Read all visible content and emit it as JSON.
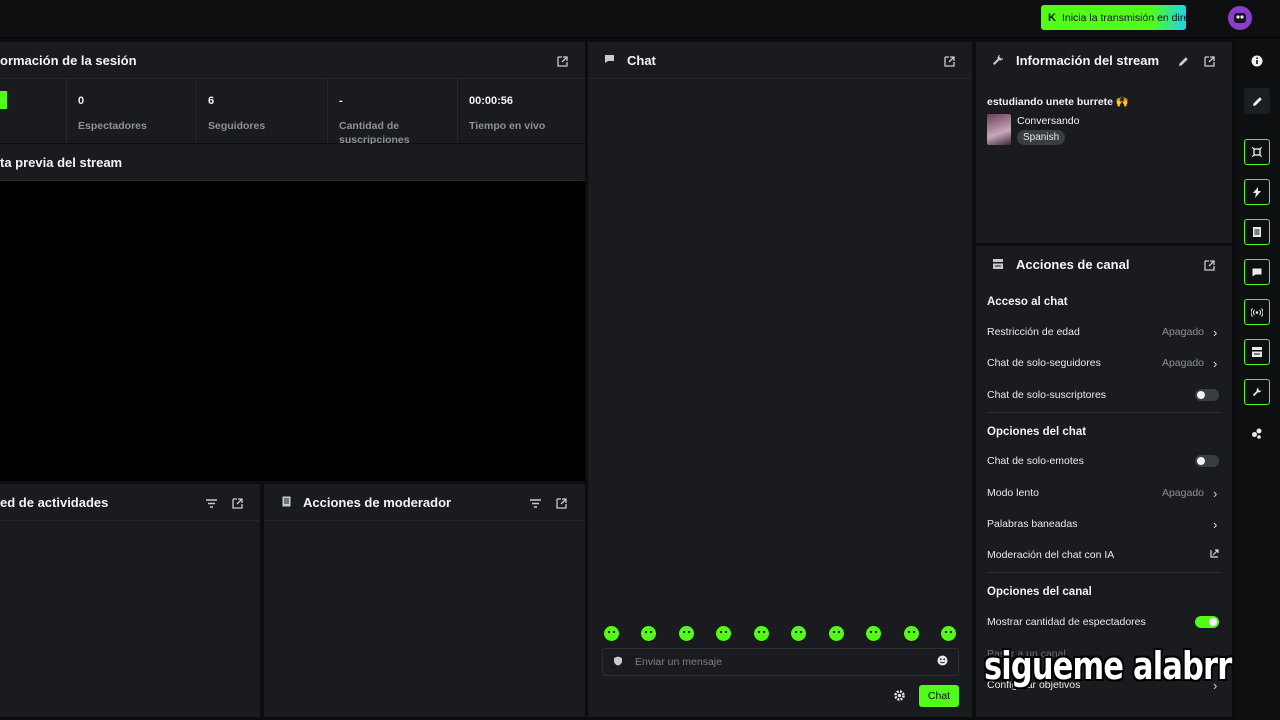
{
  "topbar": {
    "go_live_label": "Inicia la transmisión en directo",
    "accent": "#53fc18"
  },
  "session": {
    "title": "ormación de la sesión",
    "stats": [
      {
        "value": "0",
        "label": "Espectadores"
      },
      {
        "value": "6",
        "label": "Seguidores"
      },
      {
        "value": "-",
        "label": "Cantidad de suscripciones"
      },
      {
        "value": "00:00:56",
        "label": "Tiempo en vivo"
      }
    ]
  },
  "preview": {
    "title": "ta previa del stream"
  },
  "activity": {
    "title": "ed de actividades"
  },
  "mod_actions": {
    "title": "Acciones de moderador"
  },
  "chat": {
    "title": "Chat",
    "input_placeholder": "Enviar un mensaje",
    "send_label": "Chat",
    "emote_count": 10
  },
  "stream_info": {
    "title": "Información del stream",
    "stream_title": "estudiando unete burrete 🙌",
    "category": "Conversando",
    "language": "Spanish"
  },
  "channel_actions": {
    "title": "Acciones de canal",
    "chat_access_heading": "Acceso al chat",
    "age_restriction": "Restricción de edad",
    "age_restriction_value": "Apagado",
    "followers_only": "Chat de solo-seguidores",
    "followers_only_value": "Apagado",
    "subscribers_only": "Chat de solo-suscriptores",
    "chat_options_heading": "Opciones del chat",
    "emotes_only": "Chat de solo-emotes",
    "slow_mode": "Modo lento",
    "slow_mode_value": "Apagado",
    "banned_words": "Palabras baneadas",
    "ai_moderation": "Moderación del chat con IA",
    "channel_options_heading": "Opciones del canal",
    "show_viewer_count": "Mostrar cantidad de espectadores",
    "show_viewer_count_on": true,
    "partial_row": "Pasar a un canal",
    "configure_goals": "Configurar objetivos"
  },
  "overlay": {
    "caption": "sigueme alabrr"
  }
}
